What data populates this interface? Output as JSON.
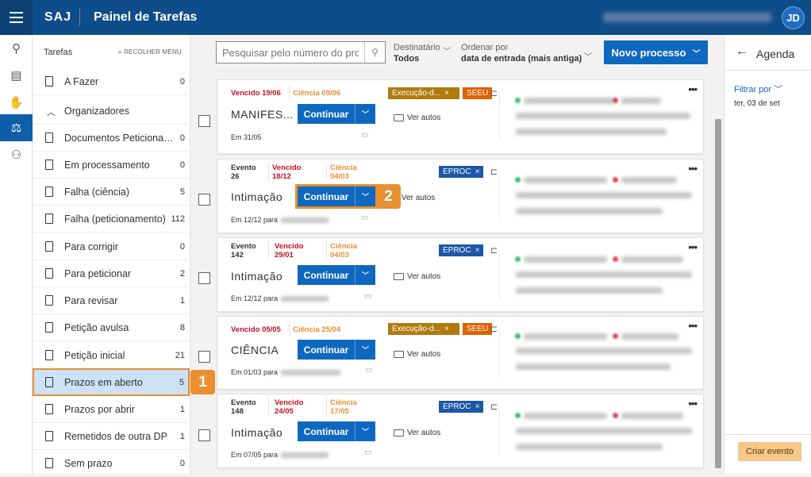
{
  "header": {
    "brand": "SAJ",
    "title": "Painel de Tarefas",
    "avatar": "JD"
  },
  "sidebar": {
    "title": "Tarefas",
    "collapse": "« RECOLHER MENU",
    "items": [
      {
        "label": "A Fazer",
        "count": "0"
      },
      {
        "label": "Organizadores"
      },
      {
        "label": "Documentos Peticionados",
        "count": "0"
      },
      {
        "label": "Em processamento",
        "count": "0"
      },
      {
        "label": "Falha (ciência)",
        "count": "5"
      },
      {
        "label": "Falha (peticionamento)",
        "count": "112"
      },
      {
        "label": "Para corrigir",
        "count": "0"
      },
      {
        "label": "Para peticionar",
        "count": "2"
      },
      {
        "label": "Para revisar",
        "count": "1"
      },
      {
        "label": "Petição avulsa",
        "count": "8"
      },
      {
        "label": "Petição inicial",
        "count": "21"
      },
      {
        "label": "Prazos em aberto",
        "count": "5"
      },
      {
        "label": "Prazos por abrir",
        "count": "1"
      },
      {
        "label": "Remetidos de outra DP",
        "count": "1"
      },
      {
        "label": "Sem prazo",
        "count": "0"
      }
    ]
  },
  "toolbar": {
    "search_placeholder": "Pesquisar pelo número do processo",
    "dest_label": "Destinatário",
    "dest_value": "Todos",
    "order_label": "Ordenar por",
    "order_value": "data de entrada (mais antiga)",
    "new_button": "Novo processo"
  },
  "cards": [
    {
      "vencido": "Vencido 19/06",
      "ciencia": "Ciência 09/06",
      "tags": [
        "Execução-d...",
        "SEEU"
      ],
      "type": "MANIFES...",
      "em": "Em 31/05"
    },
    {
      "evento": "Evento",
      "evento_num": "26",
      "vencido": "Vencido",
      "vencido_date": "18/12",
      "ciencia": "Ciência",
      "ciencia_date": "04/03",
      "tags": [
        "EPROC"
      ],
      "type": "Intimação",
      "em": "Em 12/12 para"
    },
    {
      "evento": "Evento",
      "evento_num": "142",
      "vencido": "Vencido",
      "vencido_date": "29/01",
      "ciencia": "Ciência",
      "ciencia_date": "04/03",
      "tags": [
        "EPROC"
      ],
      "type": "Intimação",
      "em": "Em 12/12 para"
    },
    {
      "vencido": "Vencido 05/05",
      "ciencia": "Ciência 25/04",
      "tags": [
        "Execução-d...",
        "SEEU"
      ],
      "type": "CIÊNCIA",
      "em": "Em 01/03 para"
    },
    {
      "evento": "Evento",
      "evento_num": "148",
      "vencido": "Vencido",
      "vencido_date": "24/05",
      "ciencia": "Ciência",
      "ciencia_date": "17/05",
      "tags": [
        "EPROC"
      ],
      "type": "Intimação",
      "em": "Em 07/05 para"
    }
  ],
  "card_labels": {
    "continue": "Continuar",
    "autos": "Ver autos"
  },
  "callouts": {
    "one": "1",
    "two": "2"
  },
  "agenda": {
    "title": "Agenda",
    "filter": "Filtrar por",
    "date": "ter, 03 de set",
    "create": "Criar evento"
  }
}
